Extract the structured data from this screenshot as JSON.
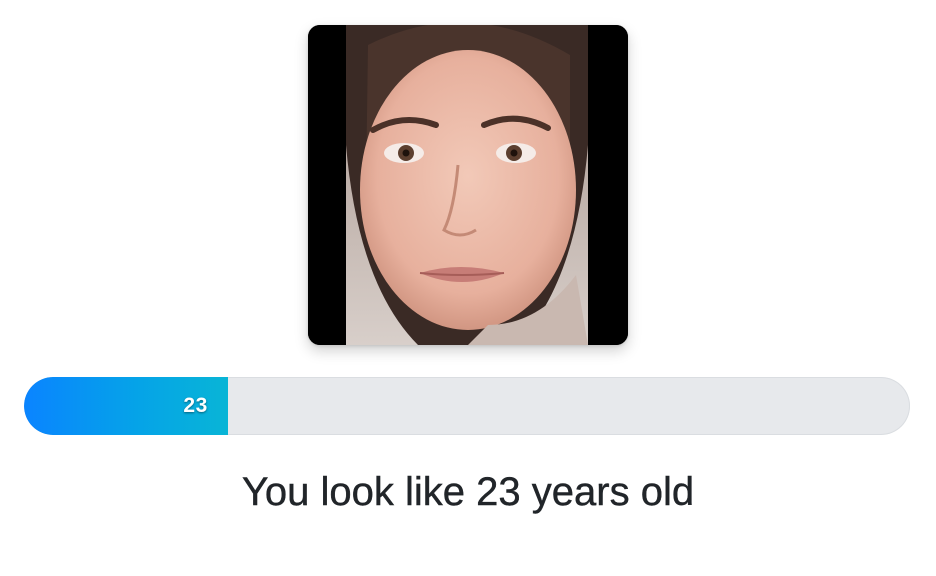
{
  "photo": {
    "icon": "face-photo",
    "background_color": "#000000"
  },
  "progress": {
    "value": 23,
    "max": 100,
    "label": "23",
    "fill_colors": [
      "#0a84ff",
      "#08b5d6"
    ],
    "track_color": "#e7e9ec"
  },
  "result": {
    "text": "You look like 23 years old"
  }
}
